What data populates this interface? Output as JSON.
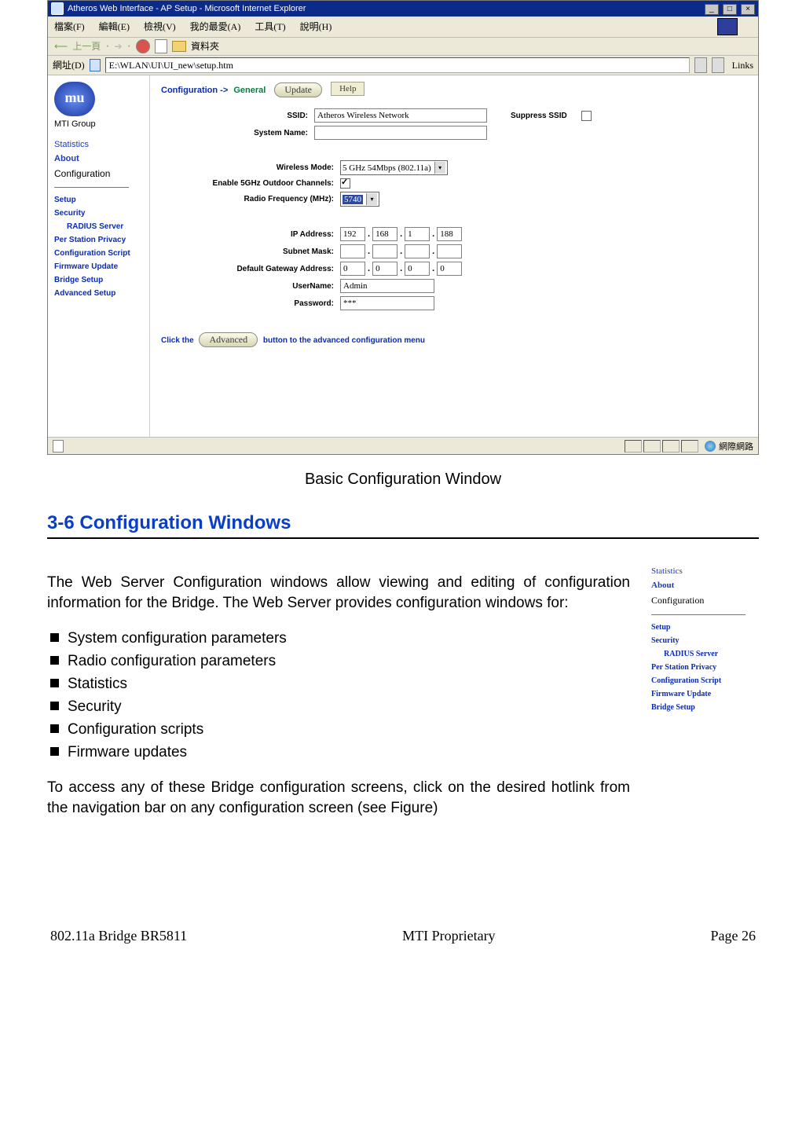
{
  "browser": {
    "title": "Atheros Web Interface - AP Setup - Microsoft Internet Explorer",
    "menu": {
      "file": "檔案(F)",
      "edit": "編輯(E)",
      "view": "檢視(V)",
      "fav": "我的最愛(A)",
      "tools": "工具(T)",
      "help": "說明(H)"
    },
    "toolbar": {
      "back": "上一頁",
      "folders": "資料夾"
    },
    "address": {
      "label": "網址(D)",
      "value": "E:\\WLAN\\UI\\UI_new\\setup.htm",
      "links": "Links"
    },
    "status": {
      "zone": "網際網路"
    }
  },
  "sidebar": {
    "group": "MTI Group",
    "top": [
      {
        "label": "Statistics",
        "cls": "lnk1"
      },
      {
        "label": "About",
        "cls": "lnk1b"
      },
      {
        "label": "Configuration",
        "cls": "sel"
      }
    ],
    "sub": [
      {
        "label": "Setup",
        "cls": "sub"
      },
      {
        "label": "Security",
        "cls": "sub"
      },
      {
        "label": "RADIUS Server",
        "cls": "sub ind"
      },
      {
        "label": "Per Station Privacy",
        "cls": "sub"
      },
      {
        "label": "Configuration Script",
        "cls": "sub"
      },
      {
        "label": "Firmware Update",
        "cls": "sub"
      },
      {
        "label": "Bridge Setup",
        "cls": "sub"
      },
      {
        "label": "Advanced Setup",
        "cls": "sub"
      }
    ]
  },
  "cfg": {
    "breadcrumb": {
      "cfg": "Configuration",
      "arrow": "->",
      "gen": "General"
    },
    "update_btn": "Update",
    "help_btn": "Help",
    "labels": {
      "ssid": "SSID:",
      "sysname": "System Name:",
      "suppress": "Suppress SSID",
      "wmode": "Wireless Mode:",
      "outdoor": "Enable 5GHz Outdoor Channels:",
      "radio": "Radio Frequency (MHz):",
      "ip": "IP Address:",
      "mask": "Subnet Mask:",
      "gw": "Default Gateway Address:",
      "user": "UserName:",
      "pass": "Password:"
    },
    "values": {
      "ssid": "Atheros Wireless Network",
      "sysname": "",
      "wmode": "5 GHz 54Mbps (802.11a)",
      "outdoor_checked": true,
      "radio": "5740",
      "ip": [
        "192",
        "168",
        "1",
        "188"
      ],
      "mask": [
        "",
        "",
        "",
        ""
      ],
      "gw": [
        "0",
        "0",
        "0",
        "0"
      ],
      "user": "Admin",
      "pass": "***"
    },
    "adv": {
      "pre": "Click the",
      "btn": "Advanced",
      "post": "button to the advanced configuration menu"
    }
  },
  "doc": {
    "caption": "Basic Configuration Window",
    "heading": "3-6 Configuration Windows",
    "para1": "The Web Server Configuration windows allow viewing and editing of configuration information for the Bridge. The Web Server provides configuration windows for:",
    "bullets": [
      "System configuration parameters",
      "Radio configuration parameters",
      "Statistics",
      "Security",
      "Configuration scripts",
      "Firmware updates"
    ],
    "para2": "To access any of these Bridge configuration screens, click on the desired hotlink from the navigation bar on any configuration screen (see Figure)"
  },
  "nav_figure": {
    "top": [
      {
        "label": "Statistics",
        "cls": "lnk1"
      },
      {
        "label": "About",
        "cls": "lnk1b"
      },
      {
        "label": "Configuration",
        "cls": "sel"
      }
    ],
    "sub": [
      {
        "label": "Setup",
        "cls": "sub"
      },
      {
        "label": "Security",
        "cls": "sub"
      },
      {
        "label": "RADIUS Server",
        "cls": "sub ind"
      },
      {
        "label": "Per Station Privacy",
        "cls": "sub"
      },
      {
        "label": "Configuration Script",
        "cls": "sub"
      },
      {
        "label": "Firmware Update",
        "cls": "sub"
      },
      {
        "label": "Bridge Setup",
        "cls": "sub"
      }
    ]
  },
  "footer": {
    "left": "802.11a Bridge BR5811",
    "center": "MTI Proprietary",
    "right": "Page 26"
  }
}
